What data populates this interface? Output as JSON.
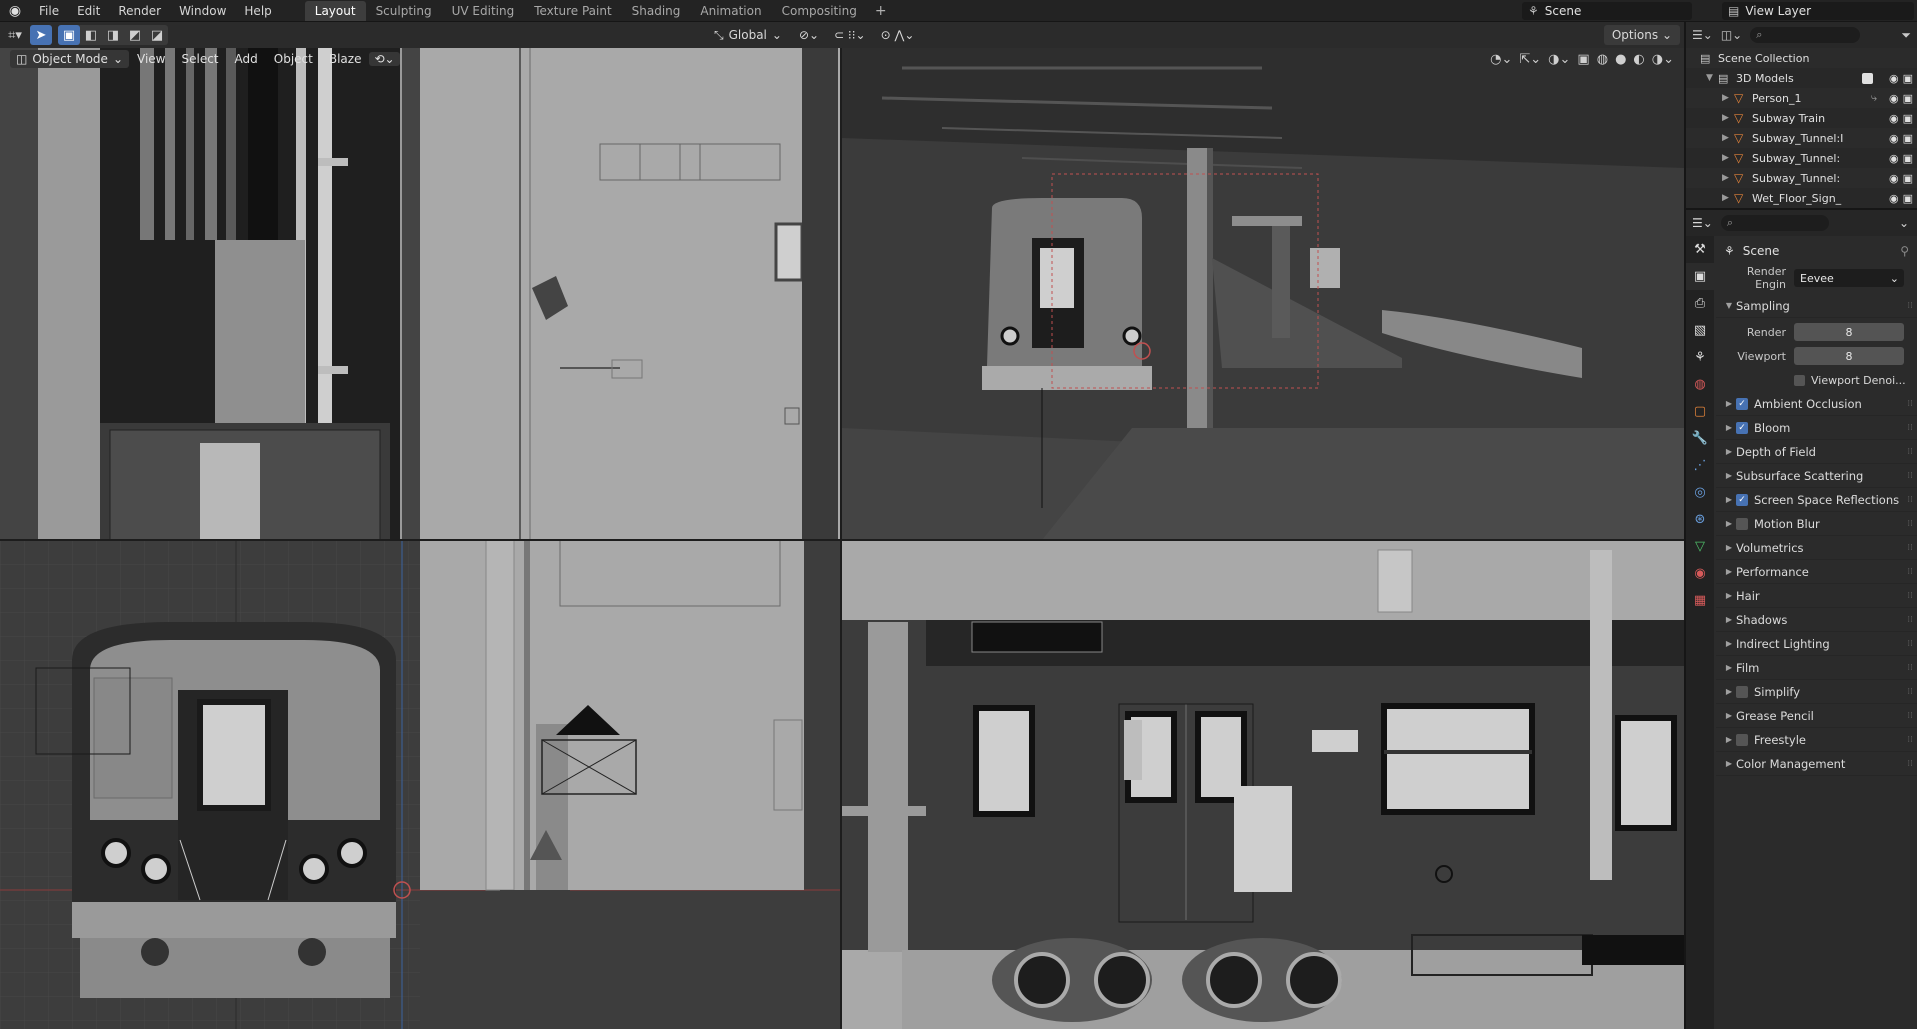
{
  "menu": {
    "items": [
      "File",
      "Edit",
      "Render",
      "Window",
      "Help"
    ]
  },
  "workspaces": {
    "tabs": [
      "Layout",
      "Sculpting",
      "UV Editing",
      "Texture Paint",
      "Shading",
      "Animation",
      "Compositing"
    ],
    "active": "Layout"
  },
  "scene_selector": {
    "value": "Scene"
  },
  "view_layer_selector": {
    "value": "View Layer"
  },
  "toolbar": {
    "transform_orientation": "Global",
    "options_label": "Options"
  },
  "viewport_header": {
    "mode": "Object Mode",
    "menus": [
      "View",
      "Select",
      "Add",
      "Object",
      "Blaze"
    ]
  },
  "outliner": {
    "root": "Scene Collection",
    "collection": "3D Models",
    "objects": [
      "Person_1",
      "Subway Train",
      "Subway_Tunnel:I",
      "Subway_Tunnel:",
      "Subway_Tunnel:",
      "Wet_Floor_Sign_"
    ]
  },
  "properties": {
    "context": "Scene",
    "render_engine_label": "Render Engin",
    "render_engine": "Eevee",
    "sampling": {
      "title": "Sampling",
      "render_label": "Render",
      "render_value": "8",
      "viewport_label": "Viewport",
      "viewport_value": "8",
      "denoise_label": "Viewport Denoi..."
    },
    "panels": [
      {
        "label": "Ambient Occlusion",
        "checkbox": true,
        "checked": true
      },
      {
        "label": "Bloom",
        "checkbox": true,
        "checked": true
      },
      {
        "label": "Depth of Field",
        "checkbox": false,
        "checked": false
      },
      {
        "label": "Subsurface Scattering",
        "checkbox": false,
        "checked": false
      },
      {
        "label": "Screen Space Reflections",
        "checkbox": true,
        "checked": true
      },
      {
        "label": "Motion Blur",
        "checkbox": true,
        "checked": false
      },
      {
        "label": "Volumetrics",
        "checkbox": false,
        "checked": false
      },
      {
        "label": "Performance",
        "checkbox": false,
        "checked": false
      },
      {
        "label": "Hair",
        "checkbox": false,
        "checked": false
      },
      {
        "label": "Shadows",
        "checkbox": false,
        "checked": false
      },
      {
        "label": "Indirect Lighting",
        "checkbox": false,
        "checked": false
      },
      {
        "label": "Film",
        "checkbox": false,
        "checked": false
      },
      {
        "label": "Simplify",
        "checkbox": true,
        "checked": false
      },
      {
        "label": "Grease Pencil",
        "checkbox": false,
        "checked": false
      },
      {
        "label": "Freestyle",
        "checkbox": true,
        "checked": false
      },
      {
        "label": "Color Management",
        "checkbox": false,
        "checked": false
      }
    ]
  },
  "colors": {
    "accent": "#4772b3",
    "object_icon": "#e0823a",
    "viewport_gray": "#a8a8a8",
    "grid_dark": "#3d3d3d"
  }
}
